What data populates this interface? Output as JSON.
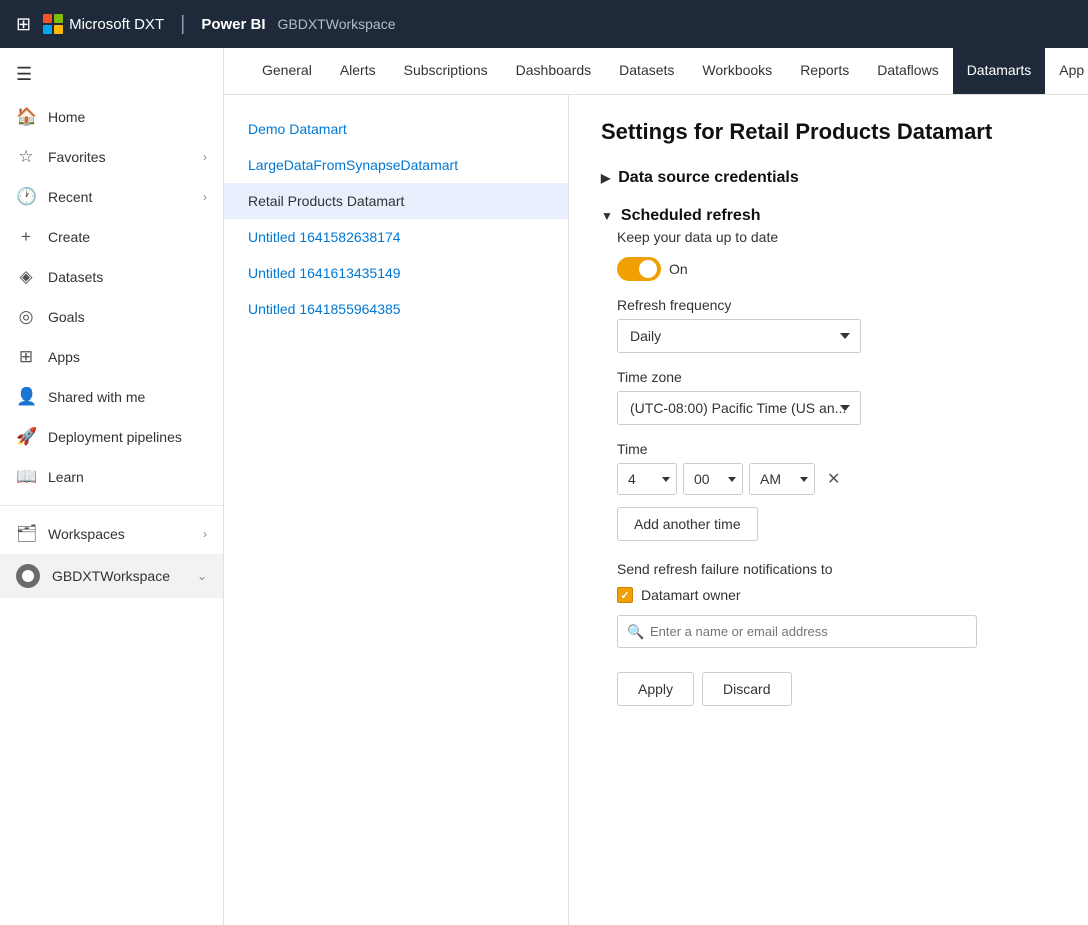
{
  "topbar": {
    "grid_icon": "⊞",
    "company": "Microsoft DXT",
    "divider": "|",
    "product": "Power BI",
    "workspace": "GBDXTWorkspace"
  },
  "sidebar": {
    "hamburger": "☰",
    "items": [
      {
        "id": "home",
        "icon": "🏠",
        "label": "Home",
        "hasChevron": false
      },
      {
        "id": "favorites",
        "icon": "★",
        "label": "Favorites",
        "hasChevron": true
      },
      {
        "id": "recent",
        "icon": "🕐",
        "label": "Recent",
        "hasChevron": true
      },
      {
        "id": "create",
        "icon": "+",
        "label": "Create",
        "hasChevron": false
      },
      {
        "id": "datasets",
        "icon": "⬡",
        "label": "Datasets",
        "hasChevron": false
      },
      {
        "id": "goals",
        "icon": "🎯",
        "label": "Goals",
        "hasChevron": false
      },
      {
        "id": "apps",
        "icon": "⊞",
        "label": "Apps",
        "hasChevron": false
      },
      {
        "id": "shared-with-me",
        "icon": "👤",
        "label": "Shared with me",
        "hasChevron": false
      },
      {
        "id": "deployment-pipelines",
        "icon": "🚀",
        "label": "Deployment pipelines",
        "hasChevron": false
      },
      {
        "id": "learn",
        "icon": "📖",
        "label": "Learn",
        "hasChevron": false
      }
    ],
    "workspaces_label": "Workspaces",
    "workspace_name": "GBDXTWorkspace"
  },
  "tabs": [
    {
      "id": "general",
      "label": "General",
      "active": false
    },
    {
      "id": "alerts",
      "label": "Alerts",
      "active": false
    },
    {
      "id": "subscriptions",
      "label": "Subscriptions",
      "active": false
    },
    {
      "id": "dashboards",
      "label": "Dashboards",
      "active": false
    },
    {
      "id": "datasets",
      "label": "Datasets",
      "active": false
    },
    {
      "id": "workbooks",
      "label": "Workbooks",
      "active": false
    },
    {
      "id": "reports",
      "label": "Reports",
      "active": false
    },
    {
      "id": "dataflows",
      "label": "Dataflows",
      "active": false
    },
    {
      "id": "datamarts",
      "label": "Datamarts",
      "active": true
    },
    {
      "id": "app",
      "label": "App",
      "active": false
    }
  ],
  "list_items": [
    {
      "id": "demo",
      "label": "Demo Datamart",
      "selected": false
    },
    {
      "id": "large",
      "label": "LargeDataFromSynapseDatamart",
      "selected": false
    },
    {
      "id": "retail",
      "label": "Retail Products Datamart",
      "selected": true
    },
    {
      "id": "untitled1",
      "label": "Untitled 1641582638174",
      "selected": false
    },
    {
      "id": "untitled2",
      "label": "Untitled 1641613435149",
      "selected": false
    },
    {
      "id": "untitled3",
      "label": "Untitled 1641855964385",
      "selected": false
    }
  ],
  "settings": {
    "title": "Settings for Retail Products Datamart",
    "data_source_credentials": "Data source credentials",
    "scheduled_refresh": "Scheduled refresh",
    "keep_data_label": "Keep your data up to date",
    "toggle_on_label": "On",
    "refresh_frequency_label": "Refresh frequency",
    "refresh_frequency_value": "Daily",
    "timezone_label": "Time zone",
    "timezone_value": "(UTC-08:00) Pacific Time (US an...",
    "time_label": "Time",
    "time_hour": "4",
    "time_minute": "00",
    "time_ampm": "AM",
    "add_another_time": "Add another time",
    "send_notification_label": "Send refresh failure notifications to",
    "datamart_owner_label": "Datamart owner",
    "search_placeholder": "Enter a name or email address",
    "apply_label": "Apply",
    "discard_label": "Discard"
  }
}
